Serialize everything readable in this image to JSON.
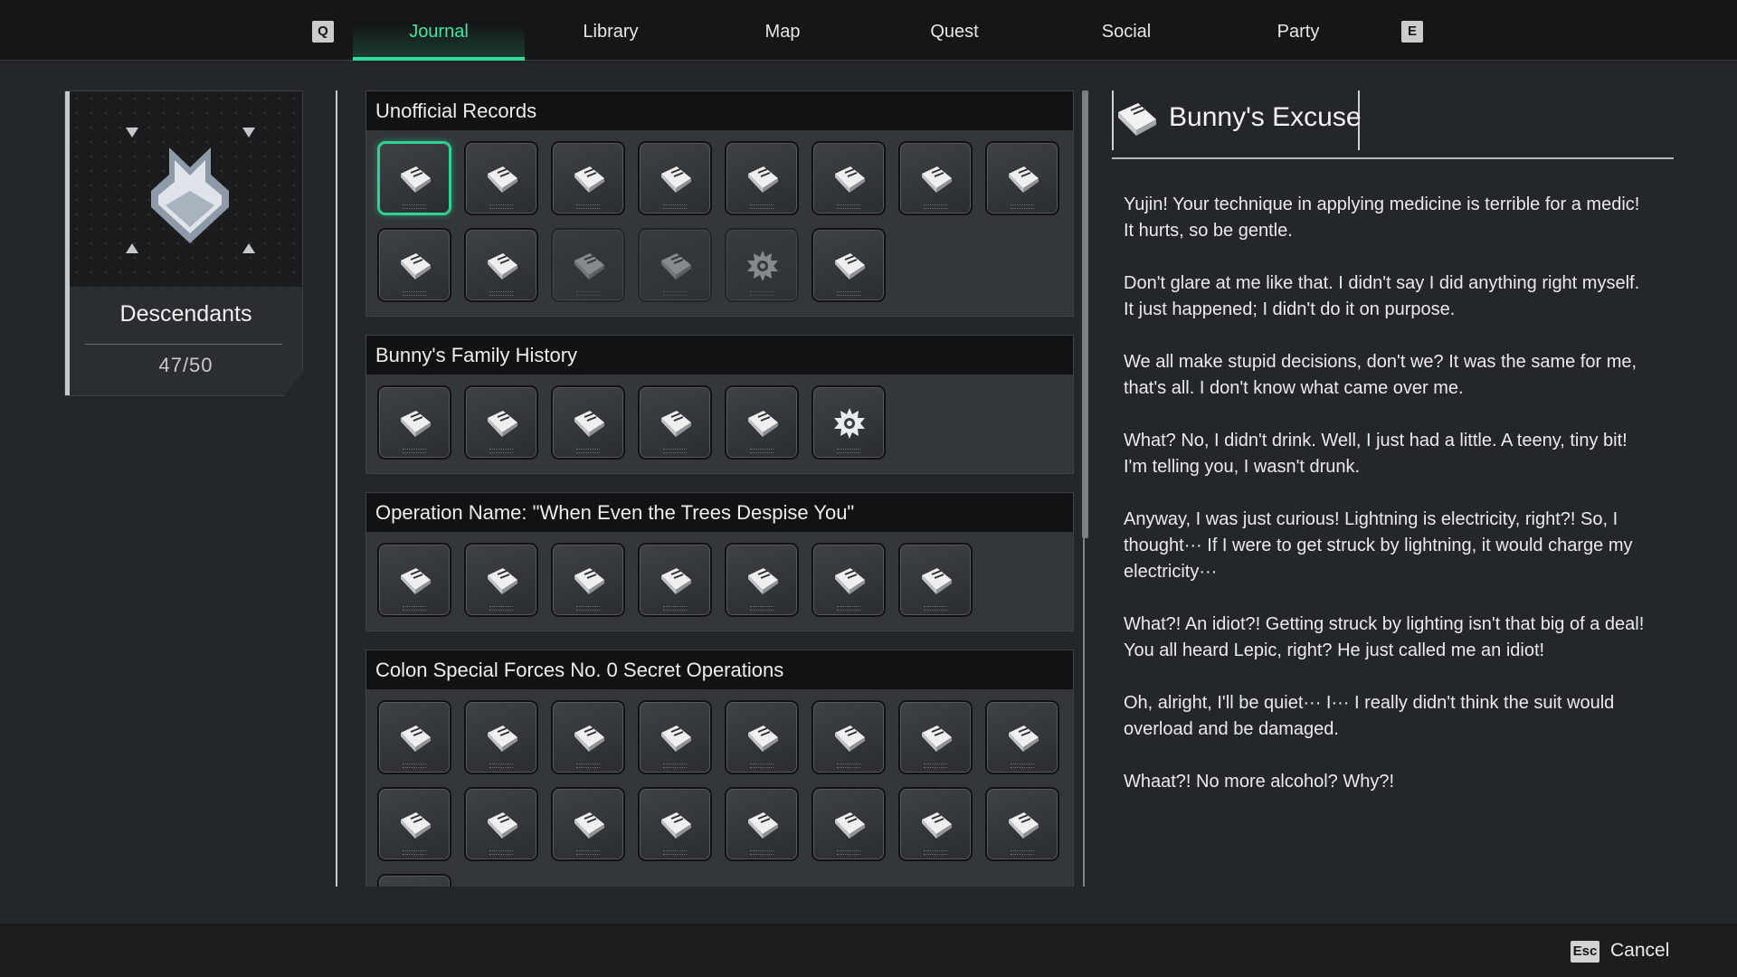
{
  "nav": {
    "prev_key": "Q",
    "next_key": "E",
    "tabs": [
      {
        "label": "Journal",
        "active": true
      },
      {
        "label": "Library",
        "active": false
      },
      {
        "label": "Map",
        "active": false
      },
      {
        "label": "Quest",
        "active": false
      },
      {
        "label": "Social",
        "active": false
      },
      {
        "label": "Party",
        "active": false
      }
    ]
  },
  "category": {
    "title": "Descendants",
    "progress": "47/50",
    "icon": "descendant-emblem-icon"
  },
  "groups": [
    {
      "title": "Unofficial Records",
      "tiles": [
        "book",
        "book",
        "book",
        "book",
        "book",
        "book",
        "book",
        "book",
        "book",
        "book",
        "book-locked",
        "book-locked",
        "gear-locked",
        "book"
      ],
      "selected_index": 0
    },
    {
      "title": "Bunny's Family History",
      "tiles": [
        "book",
        "book",
        "book",
        "book",
        "book",
        "gear"
      ]
    },
    {
      "title": "Operation Name: \"When Even the Trees Despise You\"",
      "tiles": [
        "book",
        "book",
        "book",
        "book",
        "book",
        "book",
        "book"
      ]
    },
    {
      "title": "Colon Special Forces No. 0 Secret Operations",
      "tiles": [
        "book",
        "book",
        "book",
        "book",
        "book",
        "book",
        "book",
        "book",
        "book",
        "book",
        "book",
        "book",
        "book",
        "book",
        "book",
        "book",
        "book"
      ]
    }
  ],
  "detail": {
    "title": "Bunny's Excuse",
    "icon": "book-icon",
    "paragraphs": [
      "Yujin! Your technique in applying medicine is terrible for a medic! It hurts, so be gentle.",
      "Don't glare at me like that. I didn't say I did anything right myself. It just happened; I didn't do it on purpose.",
      "We all make stupid decisions, don't we? It was the same for me, that's all. I don't know what came over me.",
      "What? No, I didn't drink. Well, I just had a little. A teeny, tiny bit! I'm telling you, I wasn't drunk.",
      "Anyway, I was just curious! Lightning is electricity, right?! So, I thought··· If I were to get struck by lightning, it would charge my electricity···",
      "What?! An idiot?! Getting struck by lighting isn't that big of a deal! You all heard Lepic, right? He just called me an idiot!",
      "Oh, alright, I'll be quiet··· I··· I really didn't think the suit would overload and be damaged.",
      "Whaat?! No more alcohol? Why?!"
    ]
  },
  "footer": {
    "key": "Esc",
    "label": "Cancel"
  },
  "colors": {
    "accent": "#35d99b",
    "background": "#24272a",
    "panel": "#33373a"
  }
}
